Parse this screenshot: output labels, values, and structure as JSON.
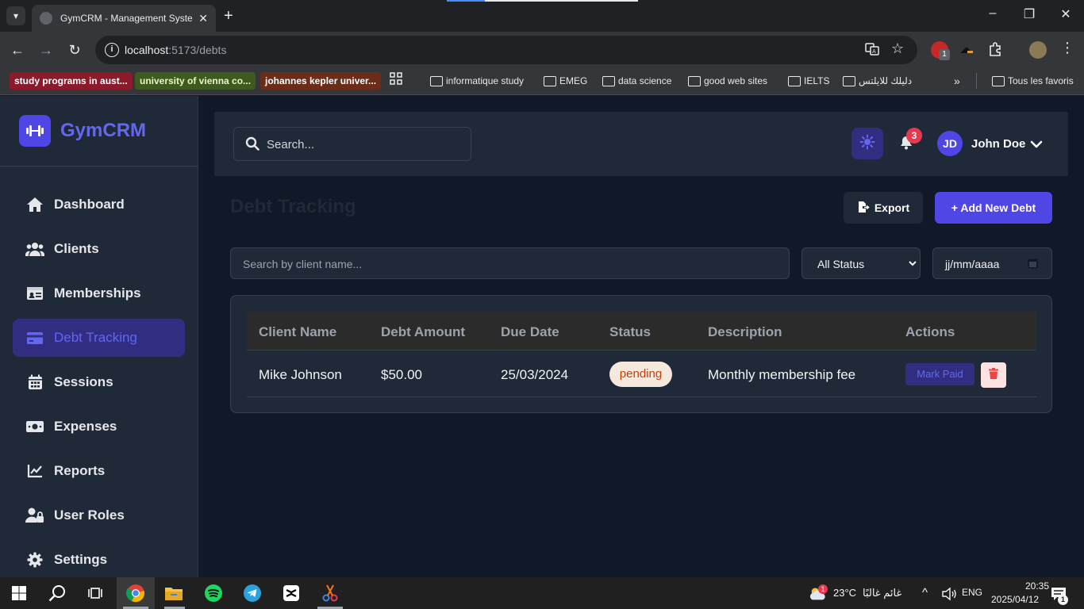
{
  "browser": {
    "tab_title": "GymCRM - Management System",
    "url_host": "localhost",
    "url_path": ":5173/debts",
    "bookmarks_chips": [
      {
        "label": "study programs in aust...",
        "bg": "#8b1a2a",
        "fg": "#ffffff"
      },
      {
        "label": "university of vienna co...",
        "bg": "#3f5a1f",
        "fg": "#e8f5c8"
      },
      {
        "label": "johannes kepler univer...",
        "bg": "#6b2d1a",
        "fg": "#ffffff"
      }
    ],
    "bookmark_folders": [
      "informatique study",
      "EMEG",
      "data science",
      "good web sites",
      "IELTS",
      "دليلك للايلتس"
    ],
    "bookmarks_overflow": "»",
    "all_bookmarks": "Tous les favoris",
    "extension_badge": "1"
  },
  "sidebar": {
    "brand": "GymCRM",
    "items": [
      {
        "label": "Dashboard",
        "icon": "home-icon"
      },
      {
        "label": "Clients",
        "icon": "users-icon"
      },
      {
        "label": "Memberships",
        "icon": "id-card-icon"
      },
      {
        "label": "Debt Tracking",
        "icon": "credit-card-icon"
      },
      {
        "label": "Sessions",
        "icon": "calendar-icon"
      },
      {
        "label": "Expenses",
        "icon": "money-icon"
      },
      {
        "label": "Reports",
        "icon": "chart-line-icon"
      },
      {
        "label": "User Roles",
        "icon": "user-lock-icon"
      },
      {
        "label": "Settings",
        "icon": "gear-icon"
      }
    ],
    "active_index": 3
  },
  "header": {
    "search_placeholder": "Search...",
    "notification_count": "3",
    "avatar_initials": "JD",
    "user_name": "John Doe"
  },
  "page": {
    "title": "Debt Tracking",
    "export_label": "Export",
    "add_label": "+ Add New Debt",
    "client_search_placeholder": "Search by client name...",
    "status_filter": "All Status",
    "date_filter": "jj/mm/aaaa"
  },
  "table": {
    "columns": [
      "Client Name",
      "Debt Amount",
      "Due Date",
      "Status",
      "Description",
      "Actions"
    ],
    "rows": [
      {
        "client": "Mike Johnson",
        "amount": "$50.00",
        "due": "25/03/2024",
        "status": "pending",
        "description": "Monthly membership fee",
        "action": "Mark Paid"
      }
    ]
  },
  "taskbar": {
    "weather_badge": "1",
    "temperature": "23°C",
    "weather_text": "غائم غالبًا",
    "language": "ENG",
    "time": "20:35",
    "date": "2025/04/12",
    "notification_count": "1"
  },
  "colors": {
    "accent": "#4f46e5",
    "sidebar_bg": "#1f2937",
    "page_bg": "#111827",
    "pending": "#c2410c"
  }
}
